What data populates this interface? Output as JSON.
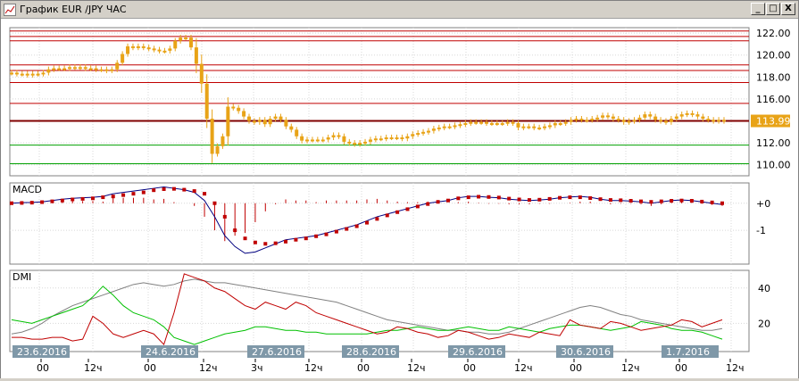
{
  "window": {
    "title": "График EUR /JPY ЧАС",
    "buttons": {
      "minimize": "_",
      "maximize": "□",
      "close": "X"
    }
  },
  "chart_data": [
    {
      "type": "candlestick",
      "panel": "price",
      "current_price": "113.99",
      "yticks": [
        "122.00",
        "120.00",
        "118.00",
        "116.00",
        "114.00",
        "112.00",
        "110.00"
      ],
      "ytick_values": [
        122,
        120,
        118,
        116,
        114,
        112,
        110
      ],
      "ylim": [
        109,
        122.5
      ],
      "hlines_red": [
        122.2,
        121.7,
        121.3,
        119.1,
        118.6,
        117.5,
        115.6
      ],
      "hline_darkred": 114.0,
      "hlines_green": [
        111.8,
        110.1
      ],
      "series": [
        {
          "name": "",
          "values": [
            118.4,
            118.3,
            118.3,
            118.2,
            118.3,
            118.3,
            118.4,
            118.7,
            118.8,
            118.8,
            118.8,
            118.9,
            118.9,
            118.9,
            118.8,
            118.8,
            118.7,
            118.7,
            118.6,
            118.7,
            119.3,
            120.1,
            120.8,
            120.7,
            120.8,
            120.7,
            120.6,
            120.5,
            120.4,
            120.4,
            120.6,
            121.3,
            121.6,
            121.6,
            120.7,
            119.2,
            117.4,
            114.2,
            111.0,
            111.7,
            112.6,
            115.3,
            115.2,
            114.9,
            114.4,
            114.0,
            113.9,
            114.1,
            113.7,
            114.2,
            114.4,
            114.1,
            113.5,
            113.2,
            112.6,
            112.2,
            112.3,
            112.3,
            112.3,
            112.3,
            112.5,
            112.7,
            112.6,
            112.1,
            112.0,
            111.9,
            112.0,
            112.1,
            112.3,
            112.4,
            112.4,
            112.5,
            112.5,
            112.5,
            112.4,
            112.6,
            112.8,
            112.9,
            113.0,
            113.1,
            113.3,
            113.4,
            113.5,
            113.5,
            113.6,
            113.7,
            113.8,
            113.9,
            113.9,
            113.9,
            113.8,
            113.8,
            113.8,
            113.8,
            113.9,
            113.8,
            113.4,
            113.5,
            113.5,
            113.4,
            113.4,
            113.5,
            113.6,
            113.8,
            113.8,
            113.9,
            114.1,
            114.2,
            114.1,
            114.1,
            114.2,
            114.3,
            114.5,
            114.4,
            114.2,
            114.1,
            113.9,
            114.0,
            114.1,
            114.3,
            114.6,
            114.4,
            114.1,
            114.0,
            113.9,
            114.2,
            114.4,
            114.6,
            114.7,
            114.6,
            114.4,
            114.2,
            114.1,
            114.0,
            114.1,
            114.0
          ]
        }
      ]
    },
    {
      "type": "line",
      "panel": "MACD",
      "title": "MACD",
      "yticks": [
        "+0",
        "-1"
      ],
      "ytick_values": [
        0,
        -1
      ],
      "ylim": [
        -2.25,
        0.75
      ],
      "series": [
        {
          "name": "",
          "values": [
            0.0,
            0.02,
            0.03,
            0.05,
            0.1,
            0.15,
            0.18,
            0.2,
            0.22,
            0.25,
            0.35,
            0.4,
            0.45,
            0.5,
            0.55,
            0.6,
            0.55,
            0.5,
            0.4,
            0.1,
            -0.5,
            -1.2,
            -1.6,
            -1.85,
            -1.8,
            -1.65,
            -1.5,
            -1.35,
            -1.3,
            -1.25,
            -1.2,
            -1.1,
            -1.0,
            -0.9,
            -0.8,
            -0.65,
            -0.5,
            -0.4,
            -0.3,
            -0.2,
            -0.1,
            0.0,
            0.05,
            0.1,
            0.2,
            0.25,
            0.25,
            0.22,
            0.2,
            0.15,
            0.12,
            0.1,
            0.12,
            0.15,
            0.2,
            0.23,
            0.25,
            0.22,
            0.15,
            0.1,
            0.1,
            0.08,
            0.05,
            0.0,
            0.05,
            0.1,
            0.12,
            0.1,
            0.05,
            0.0,
            -0.05
          ]
        },
        {
          "name": "",
          "values": [
            0.0,
            0.01,
            0.02,
            0.04,
            0.07,
            0.1,
            0.14,
            0.16,
            0.18,
            0.22,
            0.25,
            0.3,
            0.35,
            0.4,
            0.48,
            0.52,
            0.53,
            0.5,
            0.45,
            0.35,
            0.0,
            -0.5,
            -1.0,
            -1.3,
            -1.45,
            -1.5,
            -1.48,
            -1.42,
            -1.35,
            -1.3,
            -1.22,
            -1.15,
            -1.05,
            -0.95,
            -0.85,
            -0.72,
            -0.58,
            -0.45,
            -0.33,
            -0.22,
            -0.12,
            -0.03,
            0.05,
            0.1,
            0.18,
            0.22,
            0.24,
            0.23,
            0.21,
            0.17,
            0.14,
            0.12,
            0.13,
            0.16,
            0.2,
            0.22,
            0.22,
            0.19,
            0.15,
            0.12,
            0.11,
            0.09,
            0.07,
            0.05,
            0.07,
            0.09,
            0.1,
            0.09,
            0.06,
            0.03,
            0.0
          ]
        }
      ]
    },
    {
      "type": "line",
      "panel": "DMI",
      "title": "DMI",
      "yticks": [
        "40",
        "20"
      ],
      "ytick_values": [
        40,
        20
      ],
      "ylim": [
        4,
        50
      ],
      "series": [
        {
          "name": "",
          "values": [
            14,
            15,
            17,
            20,
            24,
            27,
            30,
            32,
            34,
            36,
            38,
            40,
            42,
            43,
            42,
            41,
            42,
            44,
            45,
            44,
            43,
            43,
            42,
            41,
            40,
            39,
            38,
            37,
            36,
            35,
            34,
            33,
            32,
            30,
            28,
            26,
            24,
            22,
            21,
            20,
            19,
            18,
            17,
            16,
            16,
            15,
            15,
            14,
            14,
            15,
            17,
            19,
            21,
            23,
            25,
            27,
            29,
            30,
            29,
            27,
            25,
            24,
            22,
            21,
            20,
            19,
            18,
            17,
            16,
            16,
            17
          ]
        },
        {
          "name": "",
          "values": [
            22,
            21,
            20,
            22,
            24,
            26,
            28,
            30,
            35,
            41,
            36,
            30,
            26,
            24,
            22,
            18,
            12,
            10,
            8,
            10,
            12,
            14,
            15,
            16,
            18,
            18,
            17,
            16,
            16,
            15,
            15,
            14,
            14,
            14,
            14,
            14,
            15,
            16,
            16,
            17,
            18,
            17,
            16,
            16,
            17,
            18,
            17,
            16,
            16,
            18,
            17,
            16,
            15,
            17,
            18,
            19,
            19,
            18,
            17,
            16,
            17,
            18,
            21,
            20,
            19,
            17,
            16,
            16,
            15,
            13,
            11
          ]
        },
        {
          "name": "",
          "values": [
            12,
            12,
            11,
            11,
            12,
            12,
            10,
            11,
            24,
            20,
            14,
            12,
            14,
            16,
            14,
            8,
            26,
            48,
            46,
            44,
            40,
            38,
            34,
            30,
            28,
            32,
            30,
            28,
            32,
            30,
            26,
            24,
            22,
            20,
            18,
            16,
            14,
            15,
            18,
            17,
            15,
            14,
            12,
            13,
            16,
            15,
            13,
            11,
            12,
            14,
            13,
            12,
            15,
            14,
            13,
            22,
            19,
            18,
            17,
            21,
            20,
            18,
            16,
            17,
            18,
            19,
            22,
            21,
            18,
            20,
            22
          ]
        }
      ]
    }
  ],
  "xaxis": {
    "date_labels": [
      "23.6.2016",
      "24.6.2016",
      "27.6.2016",
      "28.6.2016",
      "29.6.2016",
      "30.6.2016",
      "1.7.2016"
    ],
    "hour_labels": [
      "00",
      "12ч",
      "00",
      "12ч",
      "3ч",
      "12ч",
      "00",
      "12ч",
      "00",
      "12ч",
      "00",
      "12ч",
      "00",
      "12ч"
    ]
  },
  "colors": {
    "candle": "#e8a317",
    "hline_red": "#c00000",
    "hline_darkred": "#800000",
    "hline_green": "#00a000",
    "macd_line": "#000080",
    "macd_signal": "#c00000",
    "macd_hist": "#c00000",
    "dmi_adx": "#808080",
    "dmi_plus": "#00c000",
    "dmi_minus": "#c00000",
    "date_label_bg": "#7f98a8",
    "price_badge_bg": "#e8a317",
    "grid": "#d8d8d8"
  }
}
